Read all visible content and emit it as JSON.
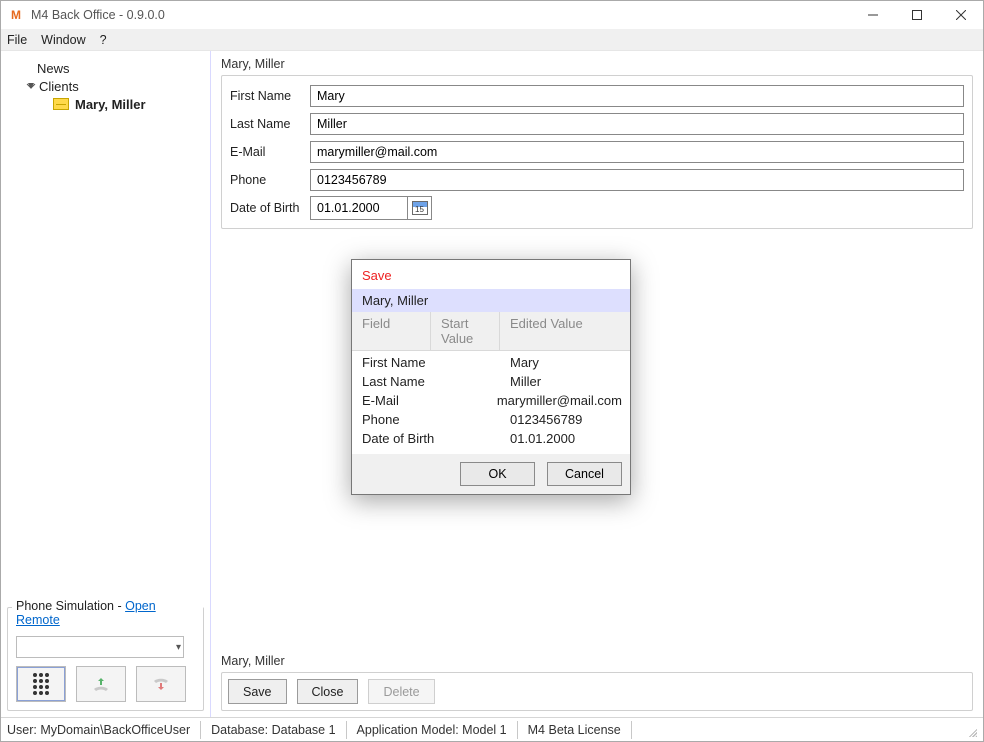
{
  "window": {
    "title": "M4 Back Office - 0.9.0.0",
    "logo_text": "M"
  },
  "window_controls": {
    "minimize": "minimize",
    "maximize": "maximize",
    "close": "close"
  },
  "menu": {
    "file": "File",
    "window": "Window",
    "help": "?"
  },
  "tree": {
    "news": "News",
    "clients": "Clients",
    "selected": "Mary, Miller"
  },
  "phone_sim": {
    "legend_prefix": "Phone Simulation - ",
    "open_remote": "Open Remote"
  },
  "breadcrumb": "Mary, Miller",
  "form": {
    "labels": {
      "first_name": "First Name",
      "last_name": "Last Name",
      "email": "E-Mail",
      "phone": "Phone",
      "dob": "Date of Birth"
    },
    "values": {
      "first_name": "Mary",
      "last_name": "Miller",
      "email": "marymiller@mail.com",
      "phone": "0123456789",
      "dob": "01.01.2000"
    },
    "calendar_day": "15"
  },
  "bottom_crumb": "Mary, Miller",
  "buttons": {
    "save": "Save",
    "close": "Close",
    "delete": "Delete"
  },
  "dialog": {
    "title": "Save",
    "entity": "Mary, Miller",
    "cols": {
      "field": "Field",
      "start": "Start Value",
      "edited": "Edited Value"
    },
    "rows": [
      {
        "field": "First Name",
        "start": "",
        "edited": "Mary"
      },
      {
        "field": "Last Name",
        "start": "",
        "edited": "Miller"
      },
      {
        "field": "E-Mail",
        "start": "",
        "edited": "marymiller@mail.com"
      },
      {
        "field": "Phone",
        "start": "",
        "edited": "0123456789"
      },
      {
        "field": "Date of Birth",
        "start": "",
        "edited": "01.01.2000"
      }
    ],
    "ok": "OK",
    "cancel": "Cancel"
  },
  "status": {
    "user": "User: MyDomain\\BackOfficeUser",
    "db": "Database: Database 1",
    "model": "Application Model: Model 1",
    "license": "M4 Beta License"
  }
}
